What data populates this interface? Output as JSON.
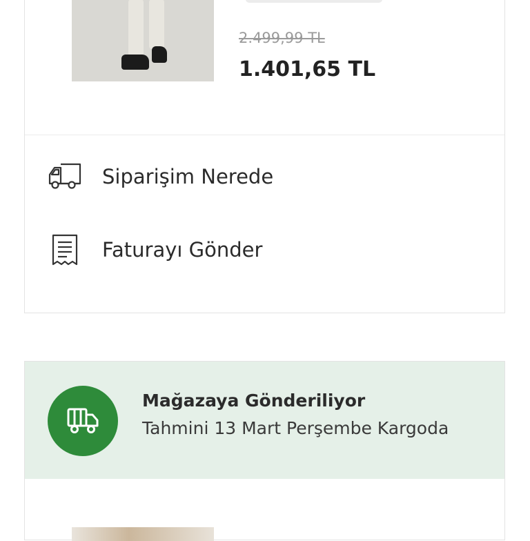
{
  "order_item": {
    "image": "product-photo-trousers",
    "old_price": "2.499,99 TL",
    "new_price": "1.401,65 TL"
  },
  "actions": [
    {
      "label": "Siparişim Nerede",
      "icon": "truck-icon"
    },
    {
      "label": "Faturayı Gönder",
      "icon": "receipt-icon"
    }
  ],
  "shipment_status": {
    "title": "Mağazaya Gönderiliyor",
    "subtitle": "Tahmini 13 Mart Perşembe Kargoda",
    "icon": "truck-icon",
    "accent_color": "#2e8b3a",
    "band_color": "#e5f0e8"
  }
}
